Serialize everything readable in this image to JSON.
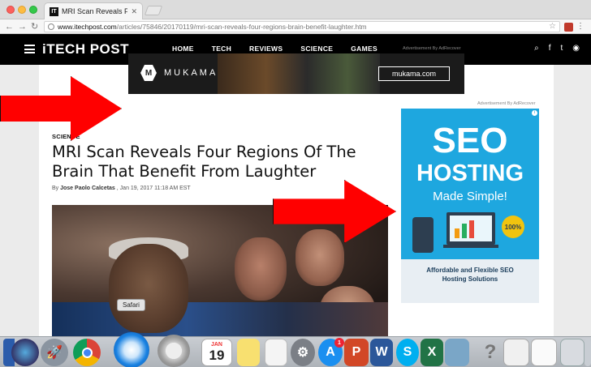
{
  "browser": {
    "tab_title": "MRI Scan Reveals Four Regio",
    "tab_favicon": "IT",
    "url_host": "www.itechpost.com",
    "url_path": "/articles/75846/20170119/mri-scan-reveals-four-regions-brain-benefit-laughter.htm"
  },
  "site": {
    "logo": "iTECH POST",
    "nav": [
      "HOME",
      "TECH",
      "REVIEWS",
      "SCIENCE",
      "GAMES"
    ]
  },
  "ads": {
    "label_top": "Advertisement By AdRecover",
    "banner_brand": "MUKAMA",
    "banner_cta": "mukama.com",
    "label_side": "Advertisement By AdRecover",
    "side_seo": "SEO",
    "side_hosting": "HOSTING",
    "side_made": "Made Simple!",
    "side_bottom_1": "Affordable and Flexible SEO",
    "side_bottom_2": "Hosting Solutions"
  },
  "article": {
    "category": "SCIENCE",
    "headline": "MRI Scan Reveals Four Regions Of The Brain That Benefit From Laughter",
    "byline_by": "By",
    "author": "Jose Paolo Calcetas",
    "date": ", Jan 19, 2017 11:18 AM EST"
  },
  "dock": {
    "tooltip": "Safari",
    "calendar_month": "JAN",
    "calendar_day": "19",
    "appstore_badge": "1"
  }
}
